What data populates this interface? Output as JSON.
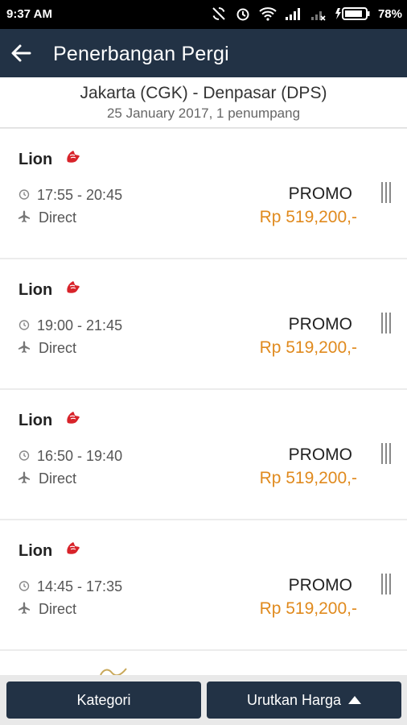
{
  "status_bar": {
    "time": "9:37 AM",
    "battery": "78%"
  },
  "app_bar": {
    "title": "Penerbangan Pergi"
  },
  "route": {
    "line1": "Jakarta (CGK) - Denpasar (DPS)",
    "line2": "25 January 2017, 1 penumpang"
  },
  "flights": [
    {
      "airline": "Lion",
      "time": "17:55 - 20:45",
      "stops": "Direct",
      "fare_class": "PROMO",
      "price": "Rp 519,200,-"
    },
    {
      "airline": "Lion",
      "time": "19:00 - 21:45",
      "stops": "Direct",
      "fare_class": "PROMO",
      "price": "Rp 519,200,-"
    },
    {
      "airline": "Lion",
      "time": "16:50 - 19:40",
      "stops": "Direct",
      "fare_class": "PROMO",
      "price": "Rp 519,200,-"
    },
    {
      "airline": "Lion",
      "time": "14:45 - 17:35",
      "stops": "Direct",
      "fare_class": "PROMO",
      "price": "Rp 519,200,-"
    }
  ],
  "bottom_bar": {
    "category_label": "Kategori",
    "sort_label": "Urutkan Harga"
  },
  "colors": {
    "primary": "#223245",
    "price": "#e08a1e",
    "logo_red": "#d8232a"
  }
}
